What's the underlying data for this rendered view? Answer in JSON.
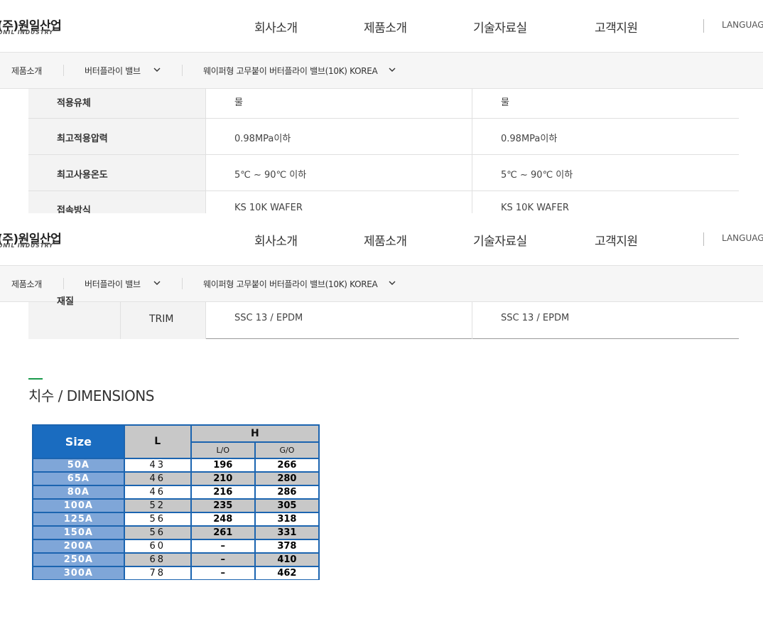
{
  "header": {
    "logo_main": "(주)원일산업",
    "logo_sub": "ONIL INDUSTRY",
    "nav": [
      "회사소개",
      "제품소개",
      "기술자료실",
      "고객지원"
    ],
    "language_label": "LANGUAGE"
  },
  "subnav": {
    "items": [
      "제품소개",
      "버터플라이 밸브",
      "웨이퍼형 고무붙이 버터플라이 밸브(10K) KOREA"
    ]
  },
  "spec_table": {
    "rows": [
      {
        "label": "적용유체",
        "c1": "물",
        "c2": "물"
      },
      {
        "label": "최고적용압력",
        "c1": "0.98MPa이하",
        "c2": "0.98MPa이하"
      },
      {
        "label": "최고사용온도",
        "c1": "5℃ ~ 90℃ 이하",
        "c2": "5℃ ~ 90℃ 이하"
      },
      {
        "label": "접속방식",
        "c1": "KS 10K WAFER",
        "c2": "KS 10K WAFER"
      }
    ]
  },
  "spec_fragment": {
    "group_label": "재질",
    "sub_label": "TRIM",
    "c1": "SSC 13 / EPDM",
    "c2": "SSC 13 / EPDM"
  },
  "dimensions": {
    "title": "치수 / DIMENSIONS",
    "headers": {
      "size": "Size",
      "l": "L",
      "h": "H",
      "lo": "L/O",
      "go": "G/O"
    },
    "rows": [
      {
        "size": "50A",
        "l": "43",
        "lo": "196",
        "go": "266"
      },
      {
        "size": "65A",
        "l": "46",
        "lo": "210",
        "go": "280"
      },
      {
        "size": "80A",
        "l": "46",
        "lo": "216",
        "go": "286"
      },
      {
        "size": "100A",
        "l": "52",
        "lo": "235",
        "go": "305"
      },
      {
        "size": "125A",
        "l": "56",
        "lo": "248",
        "go": "318"
      },
      {
        "size": "150A",
        "l": "56",
        "lo": "261",
        "go": "331"
      },
      {
        "size": "200A",
        "l": "60",
        "lo": "–",
        "go": "378"
      },
      {
        "size": "250A",
        "l": "68",
        "lo": "–",
        "go": "410"
      },
      {
        "size": "300A",
        "l": "78",
        "lo": "–",
        "go": "462"
      }
    ]
  }
}
